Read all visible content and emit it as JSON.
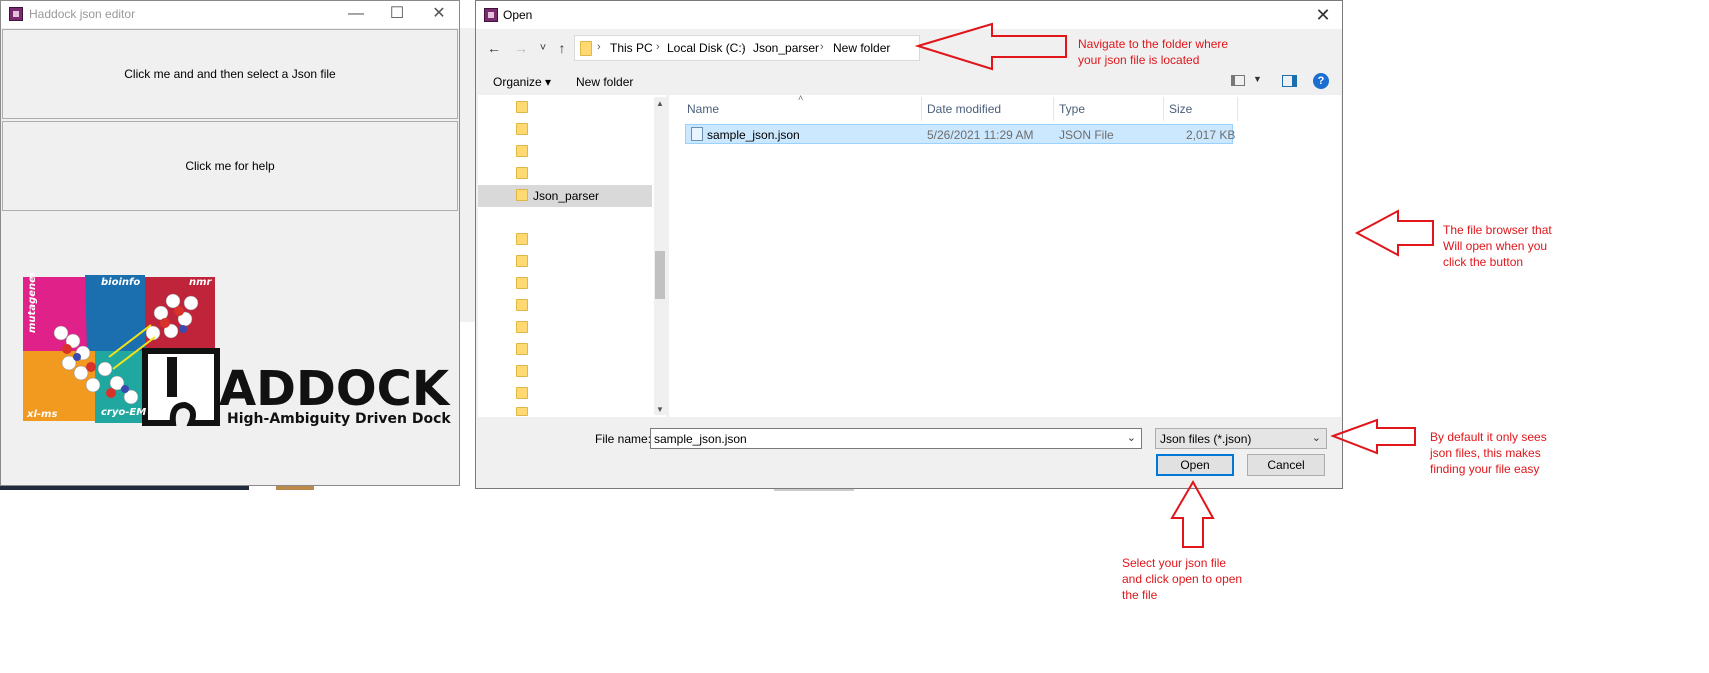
{
  "haddock_window": {
    "title": "Haddock json editor",
    "minimize": "—",
    "maximize": "☐",
    "close": "✕",
    "select_button": "Click me and and then select a Json file",
    "help_button": "Click me for help",
    "logo": {
      "wordmark": "ADDOCK",
      "tagline": "High-Ambiguity Driven Docking",
      "puzzle_labels": [
        "mutagenesis",
        "bioinfo",
        "nmr",
        "xl-ms",
        "cryo-EM"
      ]
    }
  },
  "open_dialog": {
    "title": "Open",
    "close": "✕",
    "nav": {
      "back": "←",
      "forward": "→",
      "recent": "˅",
      "up": "↑"
    },
    "breadcrumb": [
      "This PC",
      "Local Disk (C:)",
      "Json_parser",
      "New folder"
    ],
    "toolbar": {
      "organize": "Organize ▾",
      "new_folder": "New folder",
      "help": "?"
    },
    "nav_pane": {
      "selected_folder": "Json_parser"
    },
    "columns": [
      "Name",
      "Date modified",
      "Type",
      "Size"
    ],
    "files": [
      {
        "name": "sample_json.json",
        "date": "5/26/2021 11:29 AM",
        "type": "JSON File",
        "size": "2,017 KB"
      }
    ],
    "file_name_label": "File name:",
    "file_name_value": "sample_json.json",
    "file_type_value": "Json files (*.json)",
    "open_label": "Open",
    "cancel_label": "Cancel"
  },
  "annotations": {
    "navigate": "Navigate to the folder where\nyour json file is located",
    "browser": "The file browser that\nWill open when you\nclick the button",
    "filter": "By default it only sees\njson files, this makes\nfinding your file easy",
    "select": "Select your json file\nand click open to open\nthe file"
  },
  "colors": {
    "annotation": "#e0161b",
    "selection": "#cce8ff",
    "focus_border": "#0078d7"
  }
}
